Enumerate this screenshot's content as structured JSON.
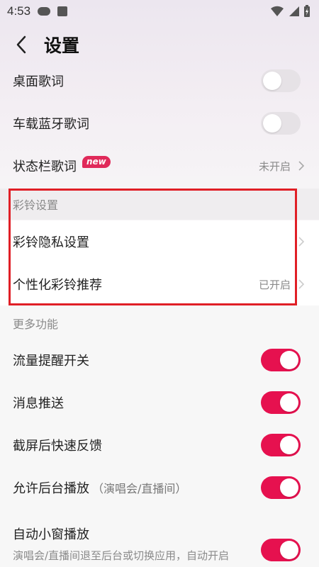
{
  "status_bar": {
    "time": "4:53"
  },
  "header": {
    "title": "设置"
  },
  "rows_top": [
    {
      "label": "桌面歌词",
      "toggle": false
    },
    {
      "label": "车载蓝牙歌词",
      "toggle": false
    },
    {
      "label": "状态栏歌词",
      "badge": "new",
      "value": "未开启"
    }
  ],
  "section_ringtone": {
    "title": "彩铃设置",
    "items": [
      {
        "label": "彩铃隐私设置"
      },
      {
        "label": "个性化彩铃推荐",
        "value": "已开启"
      }
    ]
  },
  "section_more": {
    "title": "更多功能",
    "items": [
      {
        "label": "流量提醒开关",
        "toggle": true
      },
      {
        "label": "消息推送",
        "toggle": true
      },
      {
        "label": "截屏后快速反馈",
        "toggle": true
      },
      {
        "label": "允许后台播放",
        "note": "（演唱会/直播间）",
        "toggle": true
      }
    ]
  },
  "auto_window": {
    "label": "自动小窗播放",
    "desc": "演唱会/直播间退至后台或切换应用，自动开启小窗播放",
    "toggle": true
  },
  "colors": {
    "accent": "#e6114f",
    "highlight": "#e01f26"
  }
}
